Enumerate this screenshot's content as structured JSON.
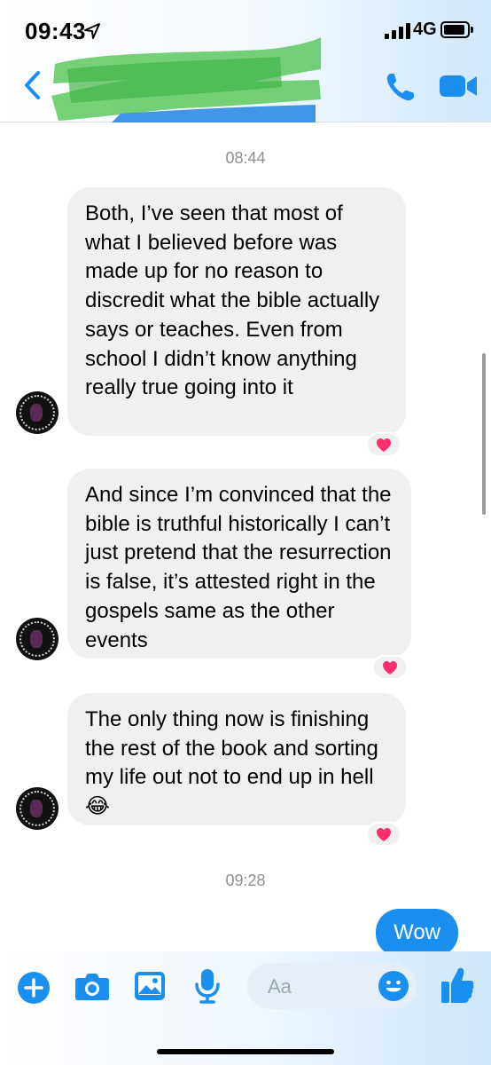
{
  "status_bar": {
    "time": "09:43",
    "network": "4G"
  },
  "header": {
    "contact_name_redacted": true
  },
  "messages": [
    {
      "type": "timestamp",
      "text": "08:44"
    },
    {
      "type": "incoming",
      "text": "Both, I’ve seen that most of what I believed before was made up for no reason to discredit what the bible actually says or teaches. Even from school I didn’t know anything really true going into it",
      "reaction": "heart"
    },
    {
      "type": "incoming",
      "text": "And since I’m convinced that the bible is truthful historically I can’t just pretend that the resurrection is false, it’s attested right in the gospels same as the other events",
      "reaction": "heart"
    },
    {
      "type": "incoming",
      "text": "The only thing now is finishing the rest of the book and sorting my life out not to end up in hell 😂",
      "reaction": "heart"
    },
    {
      "type": "timestamp",
      "text": "09:28"
    },
    {
      "type": "outgoing",
      "text": "Wow"
    }
  ],
  "composer": {
    "placeholder": "Aa"
  },
  "colors": {
    "accent": "#1b8ff0",
    "incoming_bubble": "#f0f0f0",
    "heart": "#ff2f6e",
    "timestamp": "#8e8e93"
  },
  "icons": [
    "back-chevron-icon",
    "phone-icon",
    "video-camera-icon",
    "plus-icon",
    "camera-icon",
    "image-icon",
    "microphone-icon",
    "emoji-icon",
    "thumbs-up-icon"
  ]
}
